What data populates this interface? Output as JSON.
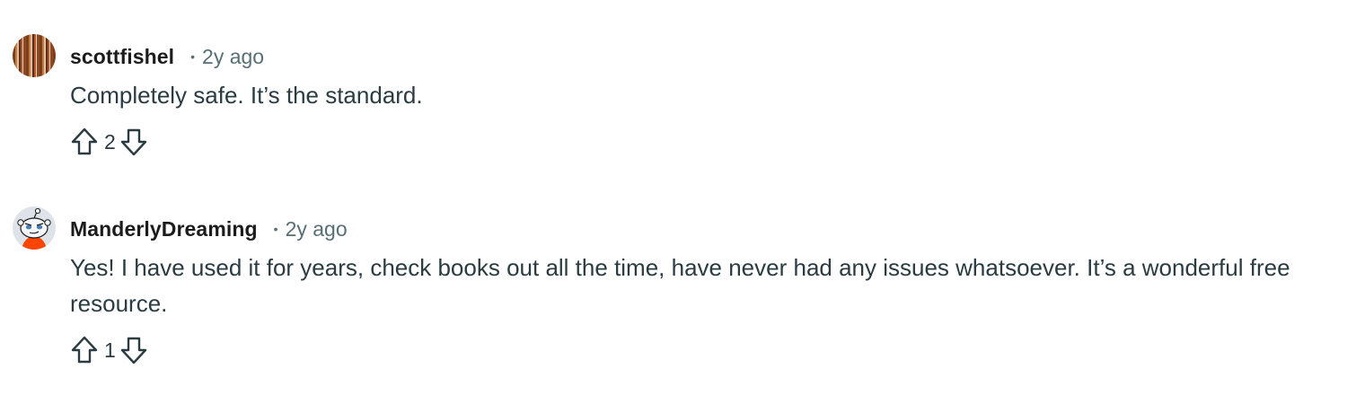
{
  "comments": [
    {
      "username": "scottfishel",
      "separator": "•",
      "time": "2y ago",
      "body": "Completely safe. It’s the standard.",
      "score": "2",
      "avatar_icon": "striped-avatar"
    },
    {
      "username": "ManderlyDreaming",
      "separator": "•",
      "time": "2y ago",
      "body": "Yes! I have used it for years, check books out all the time, have never had any issues whatsoever. It’s a wonderful free resource.",
      "score": "1",
      "avatar_icon": "snoo-avatar"
    }
  ],
  "icons": {
    "upvote": "upvote-arrow-icon",
    "downvote": "downvote-arrow-icon"
  },
  "colors": {
    "text_primary": "#1c1c1c",
    "text_body": "#2a3c42",
    "text_meta": "#576f76",
    "avatar_orange": "#ff4500"
  }
}
